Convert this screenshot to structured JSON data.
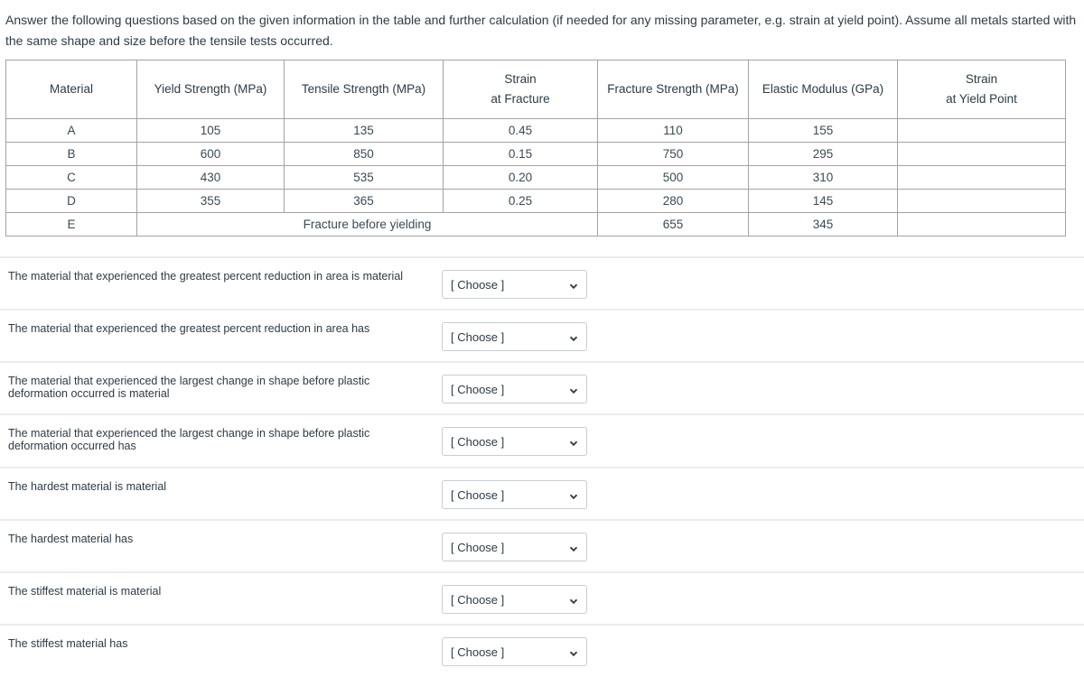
{
  "instructions": "Answer the following questions based on the given information in the table and further calculation (if needed for any missing parameter, e.g. strain at yield point). Assume all metals started with the same shape and size before the tensile tests occurred.",
  "table": {
    "headers": [
      {
        "line1": "Material",
        "line2": ""
      },
      {
        "line1": "Yield Strength (MPa)",
        "line2": ""
      },
      {
        "line1": "Tensile Strength (MPa)",
        "line2": ""
      },
      {
        "line1": "Strain",
        "line2": "at Fracture"
      },
      {
        "line1": "Fracture Strength (MPa)",
        "line2": ""
      },
      {
        "line1": "Elastic Modulus (GPa)",
        "line2": ""
      },
      {
        "line1": "Strain",
        "line2": "at Yield Point"
      }
    ],
    "rows": [
      {
        "material": "A",
        "yield": "105",
        "tensile": "135",
        "strain_fracture": "0.45",
        "fracture_strength": "110",
        "elastic_modulus": "155",
        "strain_yield": ""
      },
      {
        "material": "B",
        "yield": "600",
        "tensile": "850",
        "strain_fracture": "0.15",
        "fracture_strength": "750",
        "elastic_modulus": "295",
        "strain_yield": ""
      },
      {
        "material": "C",
        "yield": "430",
        "tensile": "535",
        "strain_fracture": "0.20",
        "fracture_strength": "500",
        "elastic_modulus": "310",
        "strain_yield": ""
      },
      {
        "material": "D",
        "yield": "355",
        "tensile": "365",
        "strain_fracture": "0.25",
        "fracture_strength": "280",
        "elastic_modulus": "145",
        "strain_yield": ""
      },
      {
        "material": "E",
        "merged_note": "Fracture before yielding",
        "fracture_strength": "655",
        "elastic_modulus": "345",
        "strain_yield": ""
      }
    ]
  },
  "questions": [
    {
      "text": "The material that experienced the greatest percent reduction in area is material",
      "selected": "[ Choose ]"
    },
    {
      "text": "The material that experienced the greatest percent reduction in area has",
      "selected": "[ Choose ]"
    },
    {
      "text": "The material that experienced the largest change in shape before plastic deformation occurred is material",
      "selected": "[ Choose ]"
    },
    {
      "text": "The material that experienced the largest change in shape before plastic deformation occurred has",
      "selected": "[ Choose ]"
    },
    {
      "text": "The hardest material is material",
      "selected": "[ Choose ]"
    },
    {
      "text": "The hardest material has",
      "selected": "[ Choose ]"
    },
    {
      "text": "The stiffest material is material",
      "selected": "[ Choose ]"
    },
    {
      "text": "The stiffest material has",
      "selected": "[ Choose ]"
    }
  ],
  "icons": {
    "dropdown": "chevron-down-icon"
  }
}
